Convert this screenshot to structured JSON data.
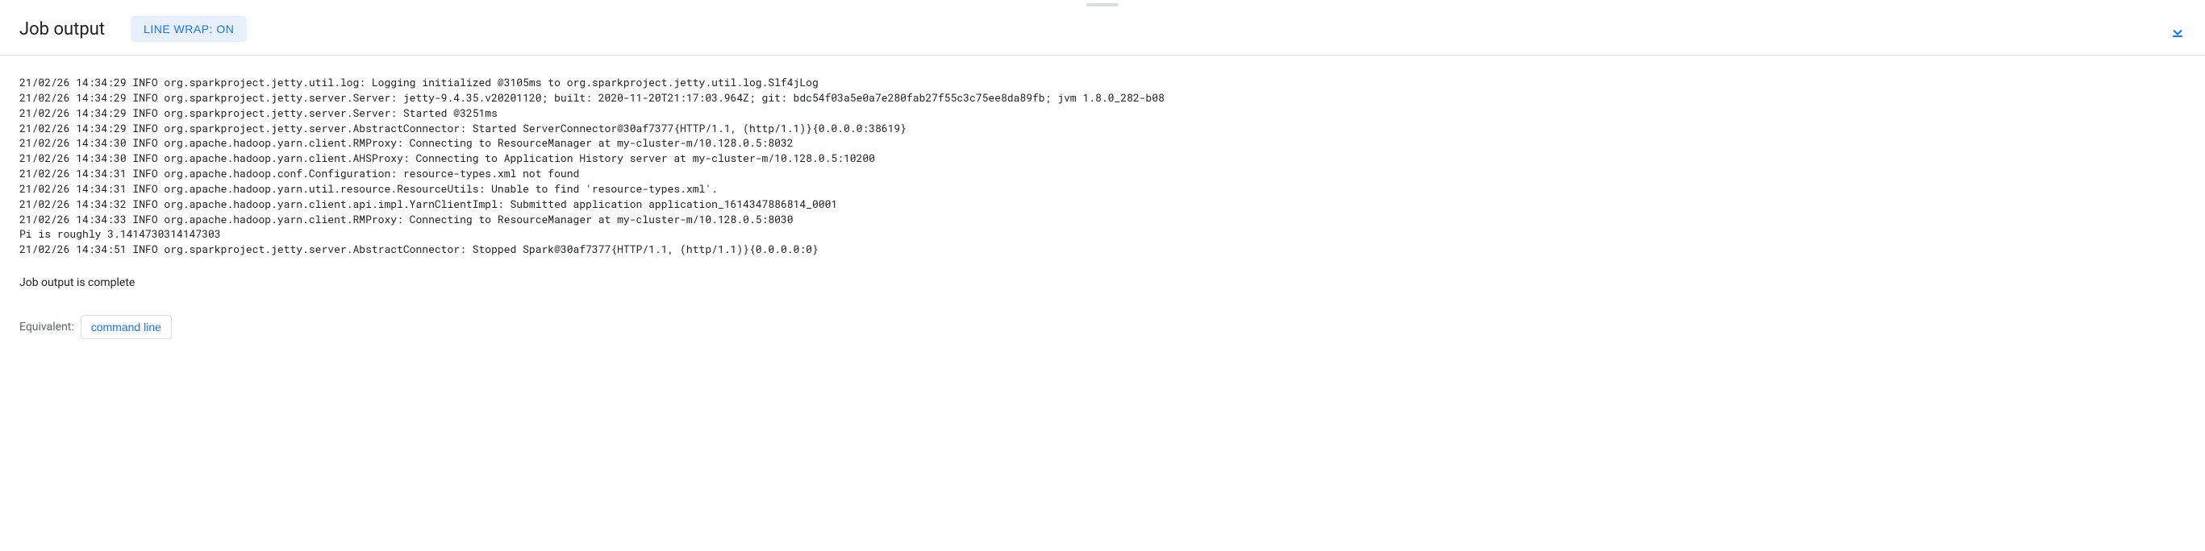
{
  "header": {
    "title": "Job output",
    "line_wrap_label": "LINE WRAP: ON"
  },
  "log_lines": [
    "21/02/26 14:34:29 INFO org.sparkproject.jetty.util.log: Logging initialized @3105ms to org.sparkproject.jetty.util.log.Slf4jLog",
    "21/02/26 14:34:29 INFO org.sparkproject.jetty.server.Server: jetty-9.4.35.v20201120; built: 2020-11-20T21:17:03.964Z; git: bdc54f03a5e0a7e280fab27f55c3c75ee8da89fb; jvm 1.8.0_282-b08",
    "21/02/26 14:34:29 INFO org.sparkproject.jetty.server.Server: Started @3251ms",
    "21/02/26 14:34:29 INFO org.sparkproject.jetty.server.AbstractConnector: Started ServerConnector@30af7377{HTTP/1.1, (http/1.1)}{0.0.0.0:38619}",
    "21/02/26 14:34:30 INFO org.apache.hadoop.yarn.client.RMProxy: Connecting to ResourceManager at my-cluster-m/10.128.0.5:8032",
    "21/02/26 14:34:30 INFO org.apache.hadoop.yarn.client.AHSProxy: Connecting to Application History server at my-cluster-m/10.128.0.5:10200",
    "21/02/26 14:34:31 INFO org.apache.hadoop.conf.Configuration: resource-types.xml not found",
    "21/02/26 14:34:31 INFO org.apache.hadoop.yarn.util.resource.ResourceUtils: Unable to find 'resource-types.xml'.",
    "21/02/26 14:34:32 INFO org.apache.hadoop.yarn.client.api.impl.YarnClientImpl: Submitted application application_1614347886814_0001",
    "21/02/26 14:34:33 INFO org.apache.hadoop.yarn.client.RMProxy: Connecting to ResourceManager at my-cluster-m/10.128.0.5:8030",
    "Pi is roughly 3.1414730314147303",
    "21/02/26 14:34:51 INFO org.sparkproject.jetty.server.AbstractConnector: Stopped Spark@30af7377{HTTP/1.1, (http/1.1)}{0.0.0.0:0}"
  ],
  "footer": {
    "status": "Job output is complete",
    "equivalent_label": "Equivalent:",
    "command_line_label": "command line"
  }
}
